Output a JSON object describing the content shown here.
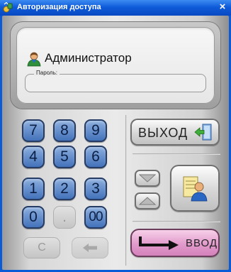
{
  "window": {
    "title": "Авторизация доступа",
    "close_glyph": "×",
    "app_icon": "key-shield-icon",
    "title_bar_color": "#0a5bd6"
  },
  "user": {
    "name": "Администратор",
    "icon": "user-avatar-icon"
  },
  "password": {
    "label": "Пароль:",
    "value": ""
  },
  "keypad": {
    "rows": [
      [
        "7",
        "8",
        "9"
      ],
      [
        "4",
        "5",
        "6"
      ],
      [
        "1",
        "2",
        "3"
      ],
      [
        "0",
        ".",
        "00"
      ]
    ],
    "clear_label": "C",
    "backspace_icon": "backspace-arrow-icon",
    "key_color": "#5a85c8"
  },
  "actions": {
    "exit_label": "ВЫХОД",
    "exit_icon": "exit-door-icon",
    "up_icon": "arrow-up-icon",
    "down_icon": "arrow-down-icon",
    "select_user_icon": "user-card-icon",
    "enter_label": "ВВОД",
    "enter_icon": "enter-arrow-icon",
    "enter_color": "#e19acb"
  }
}
